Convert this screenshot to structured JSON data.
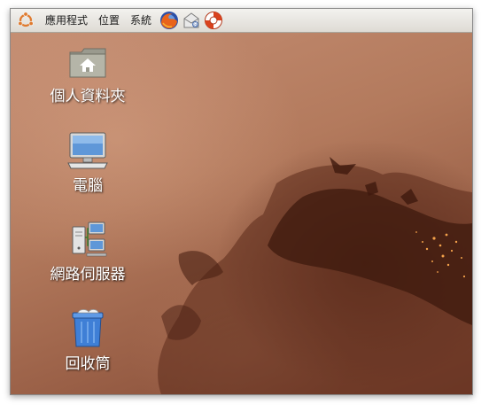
{
  "panel": {
    "logo_icon": "ubuntu-logo-icon",
    "menus": [
      {
        "label": "應用程式"
      },
      {
        "label": "位置"
      },
      {
        "label": "系統"
      }
    ],
    "launchers": [
      {
        "icon": "firefox-icon"
      },
      {
        "icon": "mail-icon"
      },
      {
        "icon": "help-lifebuoy-icon"
      }
    ]
  },
  "desktop": {
    "icons": [
      {
        "label": "個人資料夾",
        "icon": "home-folder-icon"
      },
      {
        "label": "電腦",
        "icon": "computer-icon"
      },
      {
        "label": "網路伺服器",
        "icon": "network-servers-icon"
      },
      {
        "label": "回收筒",
        "icon": "trash-icon"
      }
    ],
    "colors": {
      "wallpaper_light": "#c48d72",
      "wallpaper_dark": "#6a3420",
      "accent_orange": "#f0a040"
    }
  }
}
